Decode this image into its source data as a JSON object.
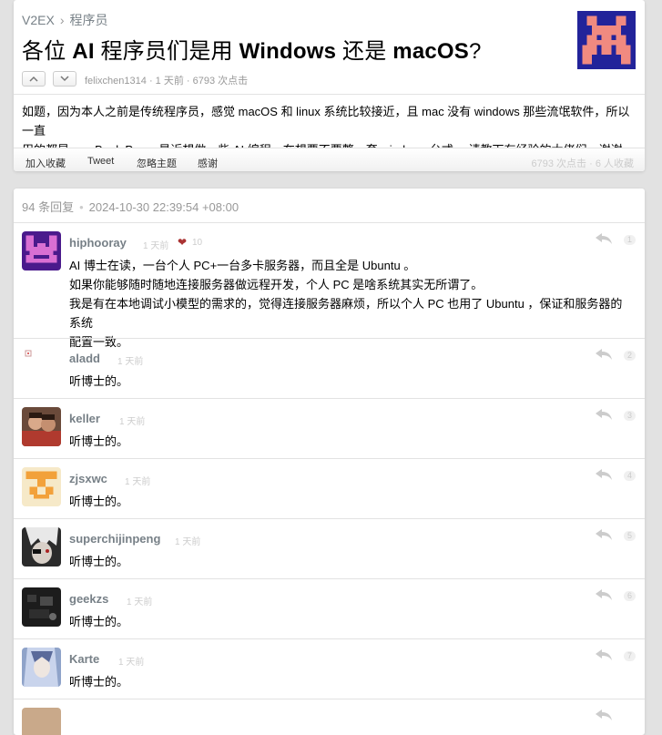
{
  "breadcrumb": {
    "site": "V2EX",
    "separator": "›",
    "node": "程序员"
  },
  "topic": {
    "title_parts": [
      "各位 ",
      "AI",
      " 程序员们是用 ",
      "Windows",
      " 还是 ",
      "macOS",
      "?"
    ],
    "meta": "felixchen1314 · 1 天前 · 6793 次点击",
    "content_lines": [
      "如题，因为本人之前是传统程序员，感觉 macOS 和 linux 系统比较接近，且 mac 没有 windows 那些流氓软件，所以一直",
      "用的都是 macBook Pro 。最近想做一些 AI 编程，在想要不要整一套 windows 台式。 请教下有经验的大佬们～谢谢"
    ]
  },
  "actions": {
    "favorite": "加入收藏",
    "tweet": "Tweet",
    "ignore": "忽略主题",
    "thanks": "感谢",
    "stats": "6793 次点击  ·  6 人收藏"
  },
  "replies_header": {
    "count": "94 条回复",
    "separator": "•",
    "date": "2024-10-30 22:39:54 +08:00"
  },
  "replies": [
    {
      "user": "hiphooray",
      "ago": "1 天前",
      "likes": "10",
      "floor": "1",
      "lines": [
        "AI 博士在读，一台个人 PC+一台多卡服务器，而且全是 Ubuntu 。",
        "如果你能够随时随地连接服务器做远程开发，个人 PC 是啥系统其实无所谓了。",
        "我是有在本地调试小模型的需求的，觉得连接服务器麻烦，所以个人 PC 也用了 Ubuntu ，保证和服务器的系统",
        "配置一致。"
      ]
    },
    {
      "user": "aladd",
      "ago": "1 天前",
      "floor": "2",
      "lines": [
        "听博士的。"
      ]
    },
    {
      "user": "keller",
      "ago": "1 天前",
      "floor": "3",
      "lines": [
        "听博士的。"
      ]
    },
    {
      "user": "zjsxwc",
      "ago": "1 天前",
      "floor": "4",
      "lines": [
        "听博士的。"
      ]
    },
    {
      "user": "superchijinpeng",
      "ago": "1 天前",
      "floor": "5",
      "lines": [
        "听博士的。"
      ]
    },
    {
      "user": "geekzs",
      "ago": "1 天前",
      "floor": "6",
      "lines": [
        "听博士的。"
      ]
    },
    {
      "user": "Karte",
      "ago": "1 天前",
      "floor": "7",
      "lines": [
        "听博士的。"
      ]
    }
  ],
  "colors": {
    "accent_link": "#778087",
    "background": "#e2e2e2",
    "heart": "#a33333"
  }
}
